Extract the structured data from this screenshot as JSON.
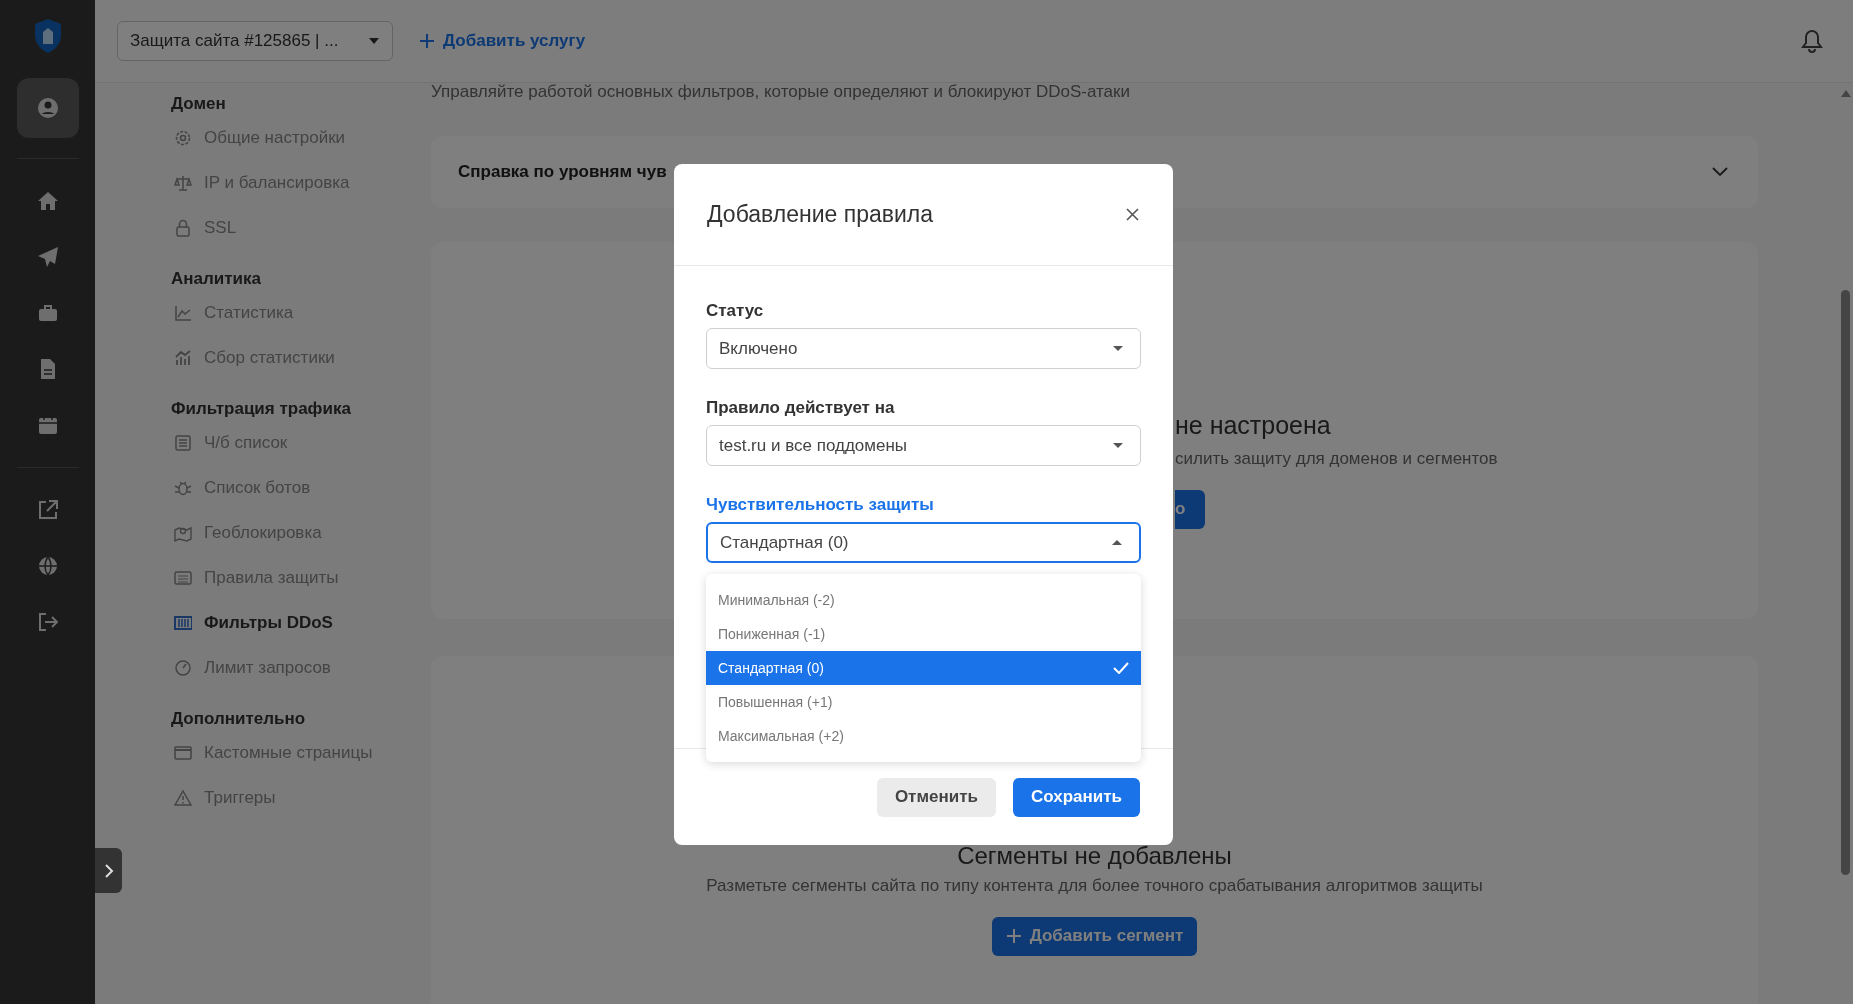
{
  "topbar": {
    "service_select": "Защита сайта #125865 | ...",
    "add_service": "Добавить услугу"
  },
  "rail": [
    {
      "selected": true
    },
    {
      "selected": false
    },
    {
      "selected": false
    },
    {
      "selected": false
    },
    {
      "selected": false
    },
    {
      "selected": false
    },
    {
      "selected": false
    },
    {
      "selected": false
    },
    {
      "selected": false
    }
  ],
  "nav": [
    {
      "heading": "Домен",
      "items": [
        {
          "label": "Общие настройки",
          "selected": false
        },
        {
          "label": "IP и балансировка",
          "selected": false
        },
        {
          "label": "SSL",
          "selected": false
        }
      ]
    },
    {
      "heading": "Аналитика",
      "items": [
        {
          "label": "Статистика",
          "selected": false
        },
        {
          "label": "Сбор статистики",
          "selected": false
        }
      ]
    },
    {
      "heading": "Фильтрация трафика",
      "items": [
        {
          "label": "Ч/б список",
          "selected": false
        },
        {
          "label": "Список ботов",
          "selected": false
        },
        {
          "label": "Геоблокировка",
          "selected": false
        },
        {
          "label": "Правила защиты",
          "selected": false
        },
        {
          "label": "Фильтры DDoS",
          "selected": true
        },
        {
          "label": "Лимит запросов",
          "selected": false
        }
      ]
    },
    {
      "heading": "Дополнительно",
      "items": [
        {
          "label": "Кастомные страницы",
          "selected": false
        },
        {
          "label": "Триггеры",
          "selected": false
        }
      ]
    }
  ],
  "content": {
    "subtitle": "Управляйте работой основных фильтров, которые определяют и блокируют DDoS-атаки",
    "help_card": {
      "title": "Справка по уровням чув"
    },
    "rules_card": {
      "title": "не настроена",
      "text": "силить защиту для доменов и сегментов",
      "button": "о"
    },
    "segments_card": {
      "title": "Сегменты не добавлены",
      "text": "Разметьте сегменты сайта по типу контента для более точного срабатывания алгоритмов защиты",
      "button": "Добавить сегмент"
    }
  },
  "modal": {
    "title": "Добавление правила",
    "fields": [
      {
        "label": "Статус",
        "value": "Включено",
        "open": false
      },
      {
        "label": "Правило действует на",
        "value": "test.ru и все поддомены",
        "open": false
      },
      {
        "label": "Чувствительность защиты",
        "value": "Стандартная (0)",
        "open": true,
        "options": [
          {
            "label": "Минимальная (-2)",
            "selected": false
          },
          {
            "label": "Пониженная (-1)",
            "selected": false
          },
          {
            "label": "Стандартная (0)",
            "selected": true
          },
          {
            "label": "Повышенная (+1)",
            "selected": false
          },
          {
            "label": "Максимальная (+2)",
            "selected": false
          }
        ]
      }
    ],
    "cancel": "Отменить",
    "save": "Сохранить"
  }
}
